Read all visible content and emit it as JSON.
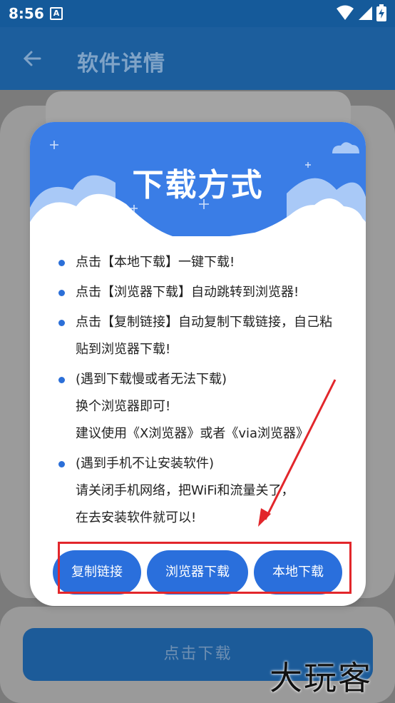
{
  "status_bar": {
    "time": "8:56",
    "notification_glyph": "A",
    "icons": [
      "wifi-icon",
      "signal-icon",
      "battery-charging-icon"
    ]
  },
  "app_bar": {
    "back_icon": "arrow-left-icon",
    "title": "软件详情"
  },
  "background": {
    "download_button": "点击下载"
  },
  "dialog": {
    "title": "下载方式",
    "items": [
      [
        "点击【本地下载】一键下载!"
      ],
      [
        "点击【浏览器下载】自动跳转到浏览器!"
      ],
      [
        "点击【复制链接】自动复制下载链接，自己粘",
        "贴到浏览器下载!"
      ],
      [
        "(遇到下载慢或者无法下载)",
        "换个浏览器即可!",
        "建议使用《X浏览器》或者《via浏览器》"
      ],
      [
        "(遇到手机不让安装软件)",
        "请关闭手机网络，把WiFi和流量关了，",
        "在去安装软件就可以!"
      ]
    ],
    "buttons": {
      "copy_link": "复制链接",
      "browser_download": "浏览器下载",
      "local_download": "本地下载"
    }
  },
  "annotation": {
    "color": "#e2262b"
  },
  "watermark": "大玩客",
  "colors": {
    "primary": "#2a6fdc",
    "header_blue": "#3a7de6",
    "app_bar": "#1c5e9d"
  }
}
